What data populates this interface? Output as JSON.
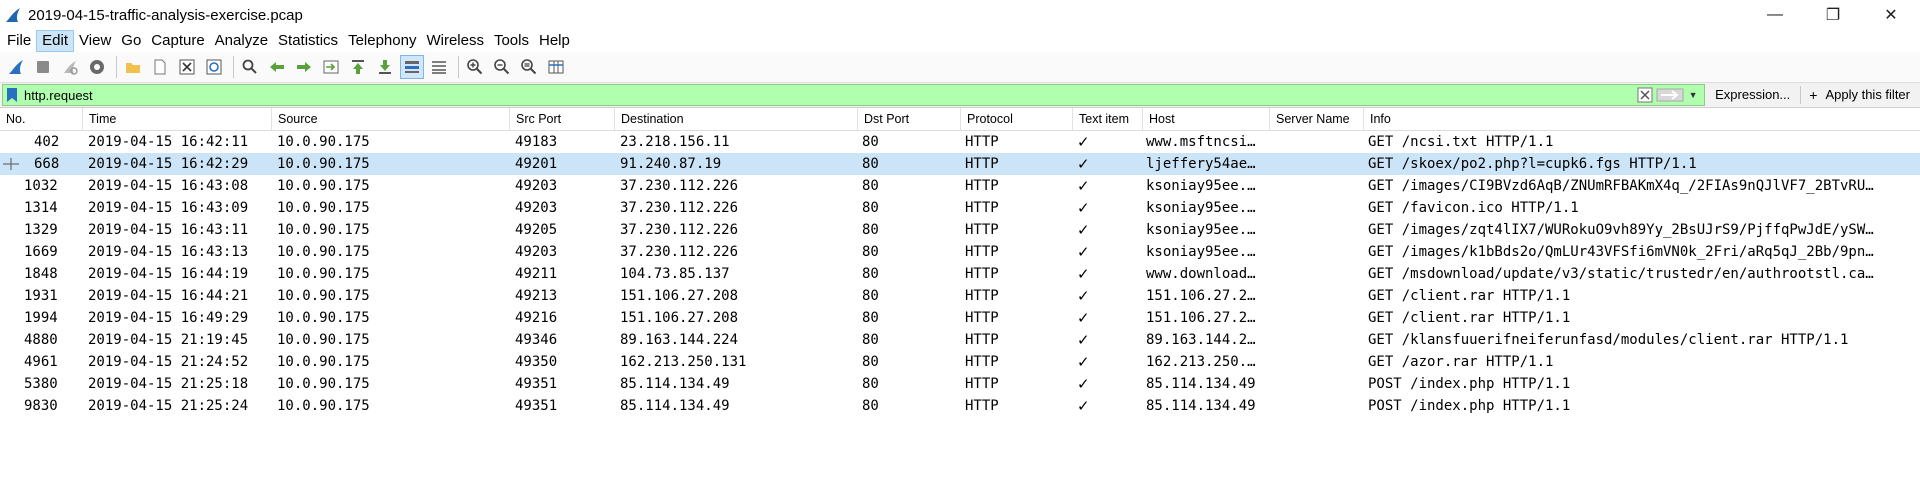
{
  "window": {
    "title": "2019-04-15-traffic-analysis-exercise.pcap",
    "controls": [
      "—",
      "❐",
      "✕"
    ]
  },
  "menu": [
    "File",
    "Edit",
    "View",
    "Go",
    "Capture",
    "Analyze",
    "Statistics",
    "Telephony",
    "Wireless",
    "Tools",
    "Help"
  ],
  "filter": {
    "value": "http.request",
    "expression_label": "Expression...",
    "plus_label": "+",
    "apply_label": "Apply this filter"
  },
  "columns": [
    "No.",
    "Time",
    "Source",
    "Src Port",
    "Destination",
    "Dst Port",
    "Protocol",
    "Text item",
    "Host",
    "Server Name",
    "Info"
  ],
  "packets": [
    {
      "no": "402",
      "time": "2019-04-15 16:42:11",
      "src": "10.0.90.175",
      "sport": "49183",
      "dst": "23.218.156.11",
      "dport": "80",
      "proto": "HTTP",
      "text": "✓",
      "host": "www.msftncsi…",
      "server": "",
      "info": "GET /ncsi.txt HTTP/1.1"
    },
    {
      "no": "668",
      "time": "2019-04-15 16:42:29",
      "src": "10.0.90.175",
      "sport": "49201",
      "dst": "91.240.87.19",
      "dport": "80",
      "proto": "HTTP",
      "text": "✓",
      "host": "ljeffery54ae…",
      "server": "",
      "info": "GET /skoex/po2.php?l=cupk6.fgs HTTP/1.1"
    },
    {
      "no": "1032",
      "time": "2019-04-15 16:43:08",
      "src": "10.0.90.175",
      "sport": "49203",
      "dst": "37.230.112.226",
      "dport": "80",
      "proto": "HTTP",
      "text": "✓",
      "host": "ksoniay95ee.…",
      "server": "",
      "info": "GET /images/CI9BVzd6AqB/ZNUmRFBAKmX4q_/2FIAs9nQJlVF7_2BTvRU…"
    },
    {
      "no": "1314",
      "time": "2019-04-15 16:43:09",
      "src": "10.0.90.175",
      "sport": "49203",
      "dst": "37.230.112.226",
      "dport": "80",
      "proto": "HTTP",
      "text": "✓",
      "host": "ksoniay95ee.…",
      "server": "",
      "info": "GET /favicon.ico HTTP/1.1"
    },
    {
      "no": "1329",
      "time": "2019-04-15 16:43:11",
      "src": "10.0.90.175",
      "sport": "49205",
      "dst": "37.230.112.226",
      "dport": "80",
      "proto": "HTTP",
      "text": "✓",
      "host": "ksoniay95ee.…",
      "server": "",
      "info": "GET /images/zqt4lIX7/WURokuO9vh89Yy_2BsUJrS9/PjffqPwJdE/ySW…"
    },
    {
      "no": "1669",
      "time": "2019-04-15 16:43:13",
      "src": "10.0.90.175",
      "sport": "49203",
      "dst": "37.230.112.226",
      "dport": "80",
      "proto": "HTTP",
      "text": "✓",
      "host": "ksoniay95ee.…",
      "server": "",
      "info": "GET /images/k1bBds2o/QmLUr43VFSfi6mVN0k_2Fri/aRq5qJ_2Bb/9pn…"
    },
    {
      "no": "1848",
      "time": "2019-04-15 16:44:19",
      "src": "10.0.90.175",
      "sport": "49211",
      "dst": "104.73.85.137",
      "dport": "80",
      "proto": "HTTP",
      "text": "✓",
      "host": "www.download…",
      "server": "",
      "info": "GET /msdownload/update/v3/static/trustedr/en/authrootstl.ca…"
    },
    {
      "no": "1931",
      "time": "2019-04-15 16:44:21",
      "src": "10.0.90.175",
      "sport": "49213",
      "dst": "151.106.27.208",
      "dport": "80",
      "proto": "HTTP",
      "text": "✓",
      "host": "151.106.27.2…",
      "server": "",
      "info": "GET /client.rar HTTP/1.1"
    },
    {
      "no": "1994",
      "time": "2019-04-15 16:49:29",
      "src": "10.0.90.175",
      "sport": "49216",
      "dst": "151.106.27.208",
      "dport": "80",
      "proto": "HTTP",
      "text": "✓",
      "host": "151.106.27.2…",
      "server": "",
      "info": "GET /client.rar HTTP/1.1"
    },
    {
      "no": "4880",
      "time": "2019-04-15 21:19:45",
      "src": "10.0.90.175",
      "sport": "49346",
      "dst": "89.163.144.224",
      "dport": "80",
      "proto": "HTTP",
      "text": "✓",
      "host": "89.163.144.2…",
      "server": "",
      "info": "GET /klansfuuerifneiferunfasd/modules/client.rar HTTP/1.1"
    },
    {
      "no": "4961",
      "time": "2019-04-15 21:24:52",
      "src": "10.0.90.175",
      "sport": "49350",
      "dst": "162.213.250.131",
      "dport": "80",
      "proto": "HTTP",
      "text": "✓",
      "host": "162.213.250.…",
      "server": "",
      "info": "GET /azor.rar HTTP/1.1"
    },
    {
      "no": "5380",
      "time": "2019-04-15 21:25:18",
      "src": "10.0.90.175",
      "sport": "49351",
      "dst": "85.114.134.49",
      "dport": "80",
      "proto": "HTTP",
      "text": "✓",
      "host": "85.114.134.49",
      "server": "",
      "info": "POST /index.php HTTP/1.1"
    },
    {
      "no": "9830",
      "time": "2019-04-15 21:25:24",
      "src": "10.0.90.175",
      "sport": "49351",
      "dst": "85.114.134.49",
      "dport": "80",
      "proto": "HTTP",
      "text": "✓",
      "host": "85.114.134.49",
      "server": "",
      "info": "POST /index.php HTTP/1.1"
    }
  ],
  "selected_packet": "668",
  "colors": {
    "filter_bg": "#afffaf",
    "selection": "#cce4f7",
    "shark_fin": "#1f66b3"
  }
}
